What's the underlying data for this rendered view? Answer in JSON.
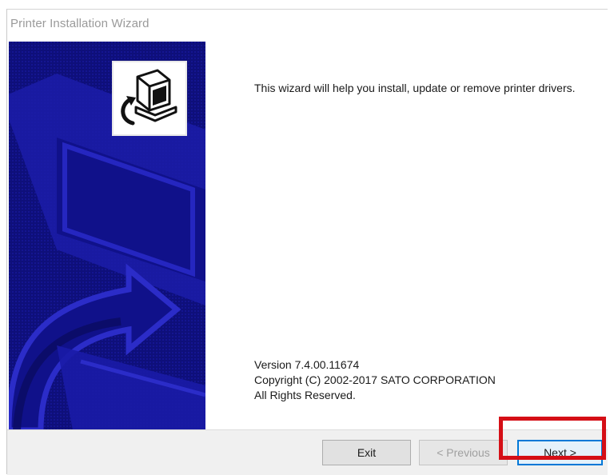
{
  "window": {
    "title": "Printer Installation Wizard"
  },
  "side_panel": {
    "logo_icon": "printer-install-icon",
    "background_color": "#0e0f7a"
  },
  "main": {
    "intro": "This wizard will help you install, update or remove printer drivers.",
    "version": "Version 7.4.00.11674",
    "copyright": "Copyright (C) 2002-2017 SATO CORPORATION",
    "rights": "All Rights Reserved."
  },
  "footer": {
    "exit_label": "Exit",
    "previous_label": "< Previous",
    "next_label": "Next >"
  },
  "annotation": {
    "highlight_color": "#d50f16",
    "highlighted_element": "next-button"
  }
}
